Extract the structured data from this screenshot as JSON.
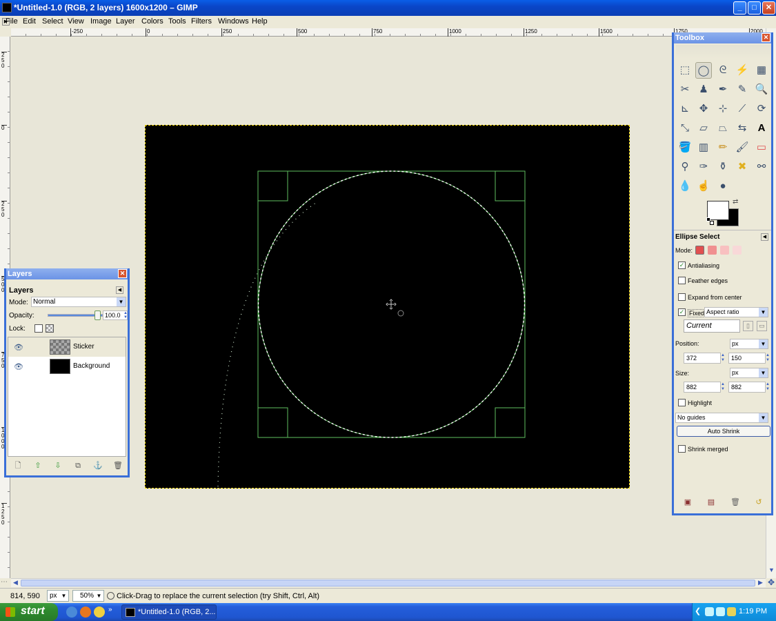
{
  "window": {
    "title": "*Untitled-1.0 (RGB, 2 layers) 1600x1200 – GIMP",
    "minimize": "_",
    "maximize": "□",
    "close": "✕"
  },
  "menu": {
    "items": [
      "File",
      "Edit",
      "Select",
      "View",
      "Image",
      "Layer",
      "Colors",
      "Tools",
      "Filters",
      "Windows",
      "Help"
    ]
  },
  "rulers": {
    "h_ticks": [
      "-250",
      "0",
      "250",
      "500",
      "750",
      "1000",
      "1250",
      "1500",
      "1750",
      "2000"
    ],
    "v_ticks": [
      "250",
      "0",
      "250",
      "500",
      "750",
      "1000",
      "1250"
    ]
  },
  "status": {
    "coords": "814, 590",
    "unit": "px",
    "zoom": "50%",
    "hint": "Click-Drag to replace the current selection (try Shift, Ctrl, Alt)"
  },
  "taskbar": {
    "start": "start",
    "task_label": "*Untitled-1.0 (RGB, 2...",
    "clock": "1:19 PM"
  },
  "layers_dock": {
    "title": "Layers",
    "tab": "Layers",
    "mode_label": "Mode:",
    "mode_value": "Normal",
    "opacity_label": "Opacity:",
    "opacity_value": "100.0",
    "opacity_level": 1.0,
    "lock_label": "Lock:",
    "layers": [
      {
        "name": "Sticker",
        "visible": true,
        "selected": true
      },
      {
        "name": "Background",
        "visible": true,
        "selected": false
      }
    ],
    "close": "✕"
  },
  "toolbox": {
    "title": "Toolbox",
    "close": "✕",
    "tool_options": {
      "title": "Ellipse Select",
      "mode_label": "Mode:",
      "antialiasing": {
        "label": "Antialiasing",
        "checked": true
      },
      "feather": {
        "label": "Feather edges",
        "checked": false
      },
      "expand": {
        "label": "Expand from center",
        "checked": false
      },
      "fixed": {
        "label": "Fixed:",
        "checked": true,
        "value": "Aspect ratio"
      },
      "current": "Current",
      "position_label": "Position:",
      "position_unit": "px",
      "position_x": "372",
      "position_y": "150",
      "size_label": "Size:",
      "size_unit": "px",
      "size_w": "882",
      "size_h": "882",
      "highlight": {
        "label": "Highlight",
        "checked": false
      },
      "guides": "No guides",
      "auto_shrink": "Auto Shrink",
      "shrink_merged": {
        "label": "Shrink merged",
        "checked": false
      }
    }
  },
  "colors": {
    "titlebar": "#0a46c8",
    "canvas_bg": "#e8e6d8",
    "selection_guide": "#5fbf5f",
    "image_bg": "#000000"
  }
}
